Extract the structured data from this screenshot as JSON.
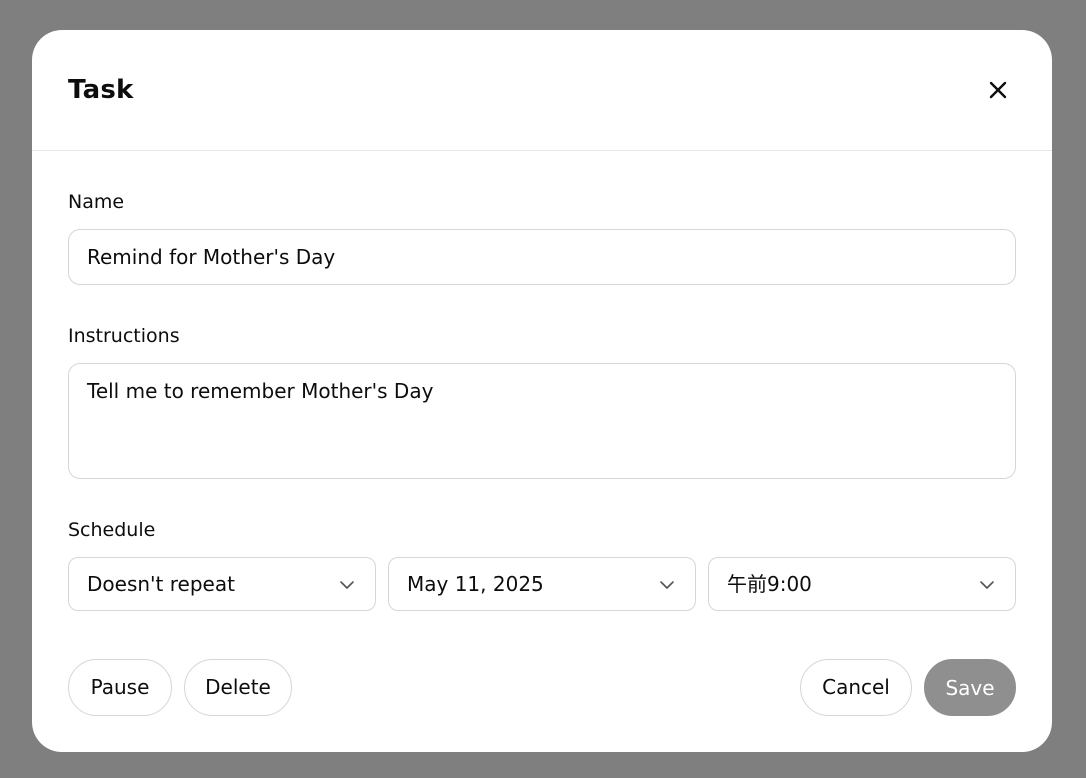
{
  "dialog": {
    "title": "Task",
    "close_icon": "close-icon"
  },
  "name_field": {
    "label": "Name",
    "value": "Remind for Mother's Day"
  },
  "instructions_field": {
    "label": "Instructions",
    "value": "Tell me to remember Mother's Day"
  },
  "schedule": {
    "label": "Schedule",
    "repeat": "Doesn't repeat",
    "date": "May 11, 2025",
    "time": "午前9:00",
    "chevron_icon": "chevron-down-icon"
  },
  "actions": {
    "pause": "Pause",
    "delete": "Delete",
    "cancel": "Cancel",
    "save": "Save"
  },
  "colors": {
    "backdrop": "#7f7f7f",
    "save_disabled": "#8f8f8f"
  }
}
